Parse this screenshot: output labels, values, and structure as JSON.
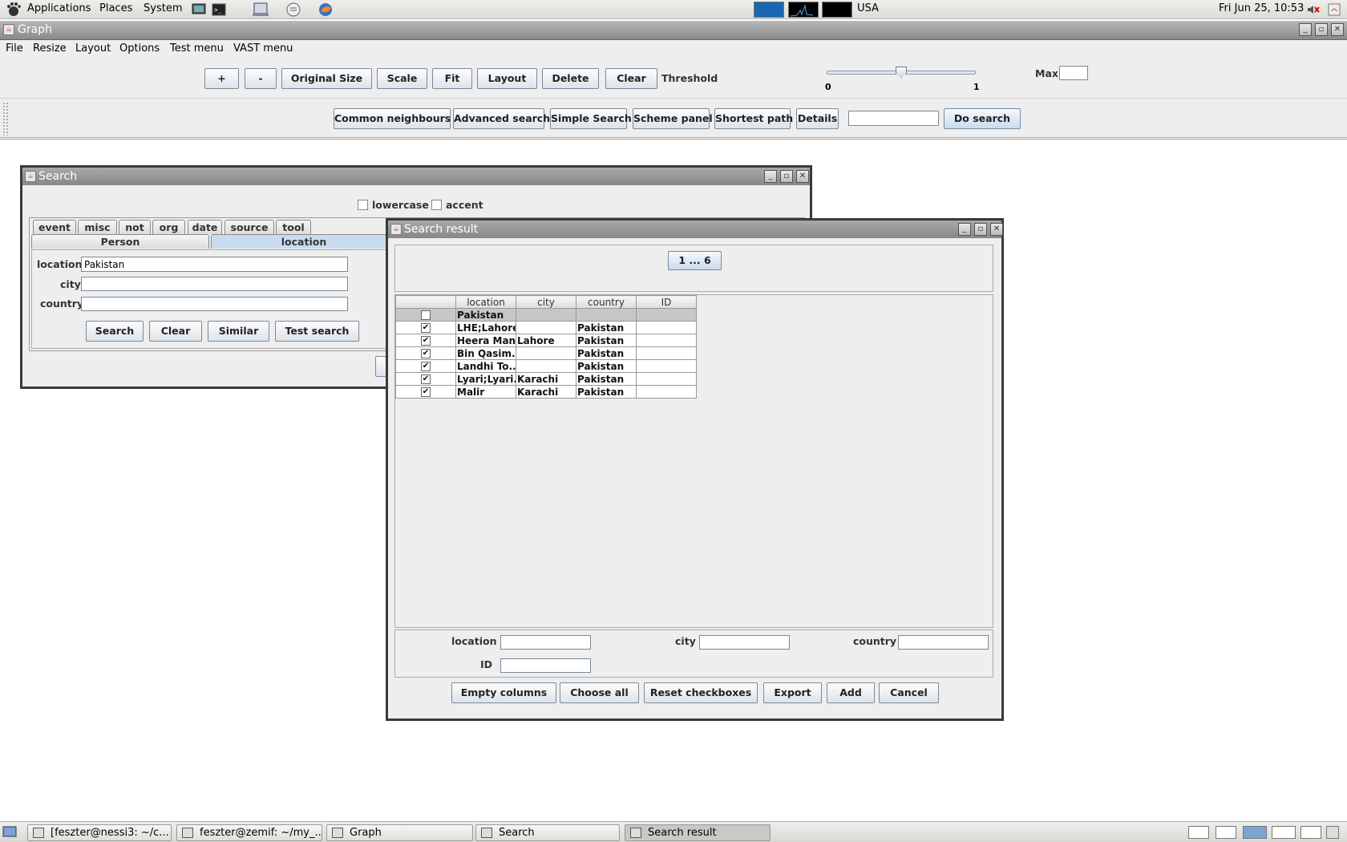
{
  "top_panel": {
    "menus": [
      "Applications",
      "Places",
      "System"
    ],
    "keyboard_layout": "USA",
    "clock": "Fri Jun 25, 10:53"
  },
  "graph_window": {
    "title": "Graph",
    "menubar": [
      "File",
      "Resize",
      "Layout",
      "Options",
      "Test menu",
      "VAST menu"
    ],
    "toolbar": {
      "buttons": [
        "+",
        "-",
        "Original Size",
        "Scale",
        "Fit",
        "Layout",
        "Delete",
        "Clear"
      ],
      "threshold_label": "Threshold",
      "slider": {
        "min_label": "0",
        "max_label": "1",
        "value": 0.5
      },
      "max_label": "Max",
      "max_value": ""
    },
    "search_bar": {
      "buttons": [
        "Common neighbours",
        "Advanced search",
        "Simple Search",
        "Scheme panel",
        "Shortest path",
        "Details"
      ],
      "query": "",
      "do_search": "Do search"
    }
  },
  "search_window": {
    "title": "Search",
    "options": [
      {
        "label": "lowercase",
        "checked": false
      },
      {
        "label": "accent",
        "checked": false
      }
    ],
    "tabs_row1": [
      "event",
      "misc",
      "not",
      "org",
      "date",
      "source",
      "tool"
    ],
    "tabs_row2": [
      "Person",
      "location"
    ],
    "selected_tab": "location",
    "fields": [
      {
        "label": "location",
        "value": "Pakistan"
      },
      {
        "label": "city",
        "value": ""
      },
      {
        "label": "country",
        "value": ""
      }
    ],
    "buttons": [
      "Search",
      "Clear",
      "Similar",
      "Test search"
    ]
  },
  "result_window": {
    "title": "Search result",
    "page_button": "1 ... 6",
    "columns": [
      "",
      "location",
      "city",
      "country",
      "ID"
    ],
    "rows": [
      {
        "checked": false,
        "location": "Pakistan",
        "city": "",
        "country": "",
        "id": "",
        "highlight": true
      },
      {
        "checked": true,
        "location": "LHE;Lahore",
        "city": "",
        "country": "Pakistan",
        "id": ""
      },
      {
        "checked": true,
        "location": "Heera Man...",
        "city": "Lahore",
        "country": "Pakistan",
        "id": ""
      },
      {
        "checked": true,
        "location": "Bin Qasim...",
        "city": "",
        "country": "Pakistan",
        "id": ""
      },
      {
        "checked": true,
        "location": "Landhi To...",
        "city": "",
        "country": "Pakistan",
        "id": ""
      },
      {
        "checked": true,
        "location": "Lyari;Lyari...",
        "city": "Karachi",
        "country": "Pakistan",
        "id": ""
      },
      {
        "checked": true,
        "location": "Malir",
        "city": "Karachi",
        "country": "Pakistan",
        "id": ""
      }
    ],
    "filter_labels": {
      "location": "location",
      "city": "city",
      "country": "country",
      "id": "ID"
    },
    "buttons": [
      "Empty columns",
      "Choose all",
      "Reset checkboxes",
      "Export",
      "Add",
      "Cancel"
    ]
  },
  "taskbar": {
    "tasks": [
      {
        "label": "[feszter@nessi3: ~/c...",
        "active": false
      },
      {
        "label": "feszter@zemif: ~/my_...",
        "active": false
      },
      {
        "label": "Graph",
        "active": false
      },
      {
        "label": "Search",
        "active": false
      },
      {
        "label": "Search result",
        "active": true
      }
    ]
  }
}
